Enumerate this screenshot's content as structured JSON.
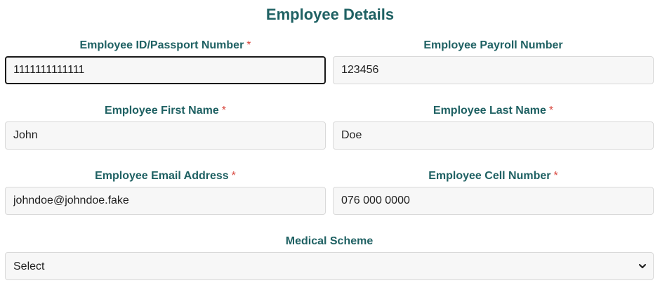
{
  "page": {
    "title": "Employee Details"
  },
  "fields": {
    "employee_id": {
      "label": "Employee ID/Passport Number",
      "required_marker": "*",
      "value": "1111111111111"
    },
    "payroll_number": {
      "label": "Employee Payroll Number",
      "value": "123456"
    },
    "first_name": {
      "label": "Employee First Name",
      "required_marker": "*",
      "value": "John"
    },
    "last_name": {
      "label": "Employee Last Name",
      "required_marker": "*",
      "value": "Doe"
    },
    "email": {
      "label": "Employee Email Address",
      "required_marker": "*",
      "value": "johndoe@johndoe.fake"
    },
    "cell_number": {
      "label": "Employee Cell Number",
      "required_marker": "*",
      "value": "076 000 0000"
    },
    "medical_scheme": {
      "label": "Medical Scheme",
      "selected": "Select"
    }
  },
  "icons": {
    "dropdown": "chevron-down-icon"
  },
  "colors": {
    "heading": "#1f6163",
    "required": "#d8453c",
    "input_background": "#f7f7f7",
    "focus_border": "#1a1a1a"
  }
}
